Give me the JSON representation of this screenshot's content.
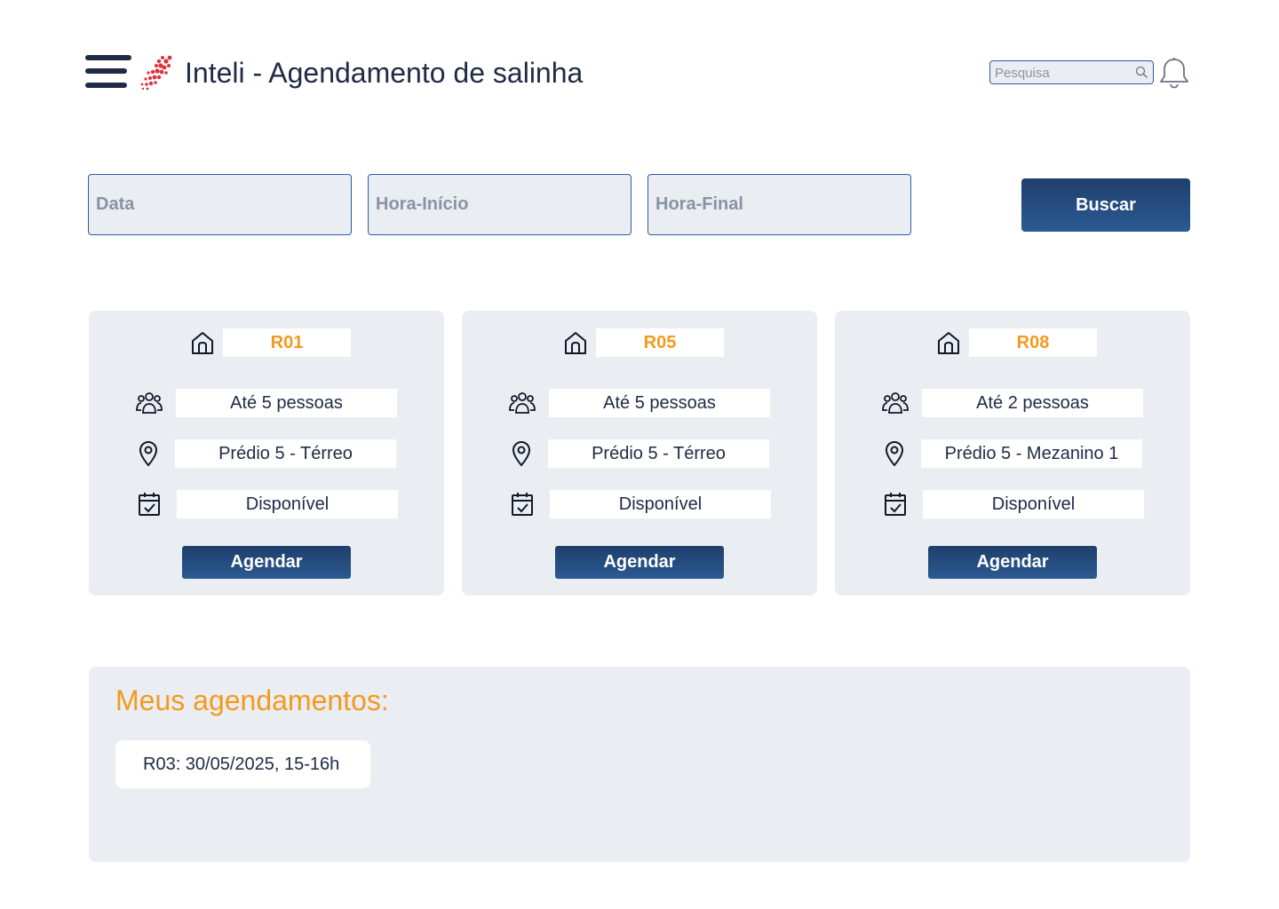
{
  "header": {
    "title": "Inteli - Agendamento de salinha",
    "menu_icon": "hamburger-menu-icon",
    "logo_icon": "inteli-logo",
    "notification_icon": "bell-icon"
  },
  "search": {
    "placeholder": "Pesquisa",
    "icon": "search-icon"
  },
  "filters": {
    "date_placeholder": "Data",
    "start_placeholder": "Hora-Início",
    "end_placeholder": "Hora-Final",
    "search_button": "Buscar"
  },
  "rooms": [
    {
      "code": "R01",
      "capacity": "Até 5 pessoas",
      "location": "Prédio 5 - Térreo",
      "status": "Disponível",
      "action": "Agendar"
    },
    {
      "code": "R05",
      "capacity": "Até 5 pessoas",
      "location": "Prédio 5 - Térreo",
      "status": "Disponível",
      "action": "Agendar"
    },
    {
      "code": "R08",
      "capacity": "Até 2 pessoas",
      "location": "Prédio 5 - Mezanino 1",
      "status": "Disponível",
      "action": "Agendar"
    }
  ],
  "bookings": {
    "title": "Meus agendamentos:",
    "items": [
      "R03: 30/05/2025, 15-16h"
    ]
  },
  "colors": {
    "primary": "#1f3f6c",
    "accent": "#f39a1e",
    "panel": "#eaedf2",
    "text": "#1f2a44",
    "logo_red": "#e0323c"
  }
}
